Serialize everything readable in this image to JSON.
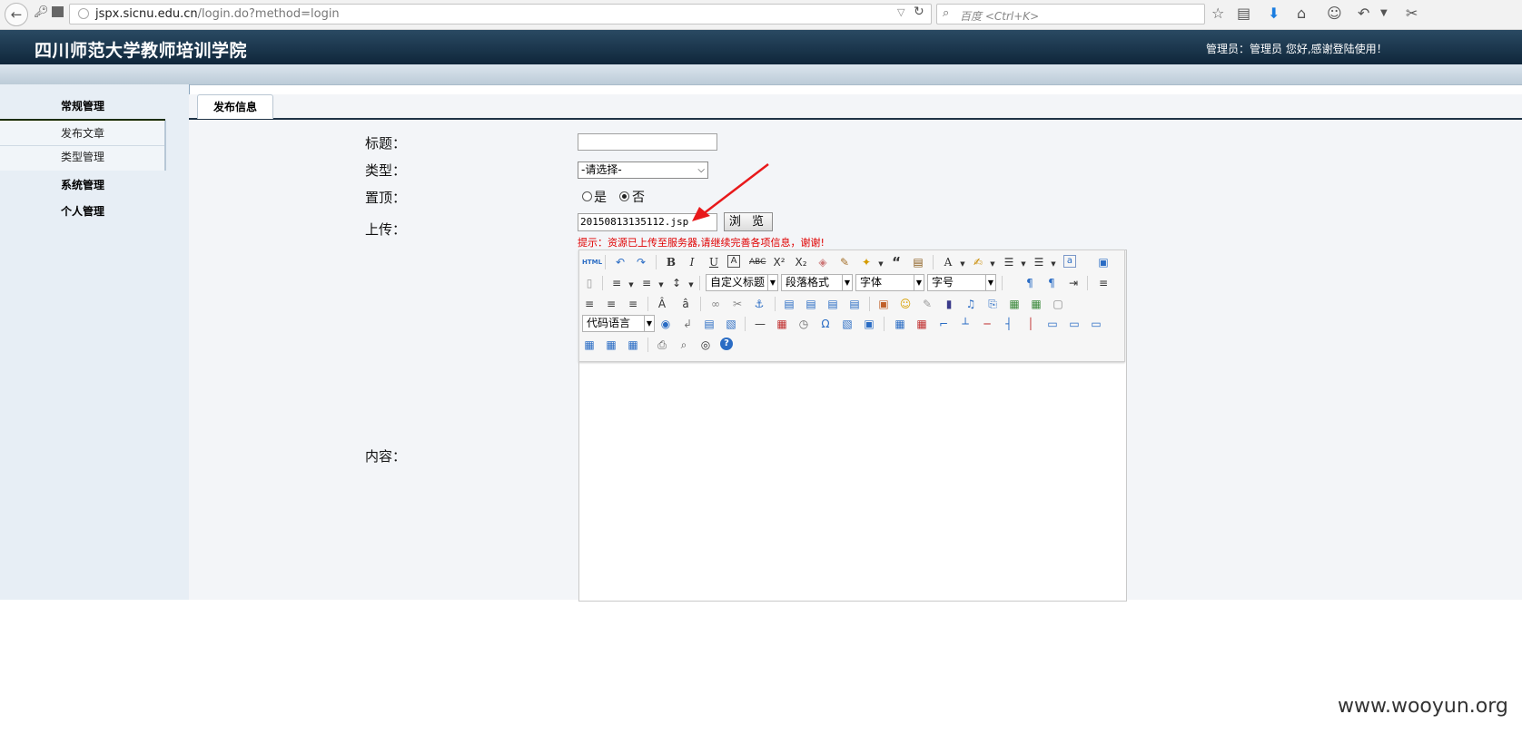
{
  "browser": {
    "url_host": "jspx.sicnu.edu.cn",
    "url_path": "/login.do?method=login",
    "search_placeholder": "百度 <Ctrl+K>"
  },
  "site": {
    "title": "四川师范大学教师培训学院",
    "greeting": "管理员：管理员 您好,感谢登陆使用！"
  },
  "sidebar": {
    "cat_general": "常规管理",
    "item_publish": "发布文章",
    "item_types": "类型管理",
    "cat_system": "系统管理",
    "cat_personal": "个人管理"
  },
  "tabs": {
    "publish": "发布信息"
  },
  "form": {
    "title_label": "标题：",
    "type_label": "类型：",
    "type_value": "-请选择-",
    "top_label": "置顶：",
    "top_yes": "是",
    "top_no": "否",
    "top_selected": "否",
    "upload_label": "上传：",
    "upload_value": "20150813135112.jsp",
    "browse_button": "浏 览",
    "upload_hint": "提示：资源已上传至服务器,请继续完善各项信息，谢谢!",
    "content_label": "内容："
  },
  "editor": {
    "custom_heading": "自定义标题",
    "paragraph_format": "段落格式",
    "font": "字体",
    "font_size": "字号",
    "code_language": "代码语言"
  },
  "watermark": "www.wooyun.org"
}
